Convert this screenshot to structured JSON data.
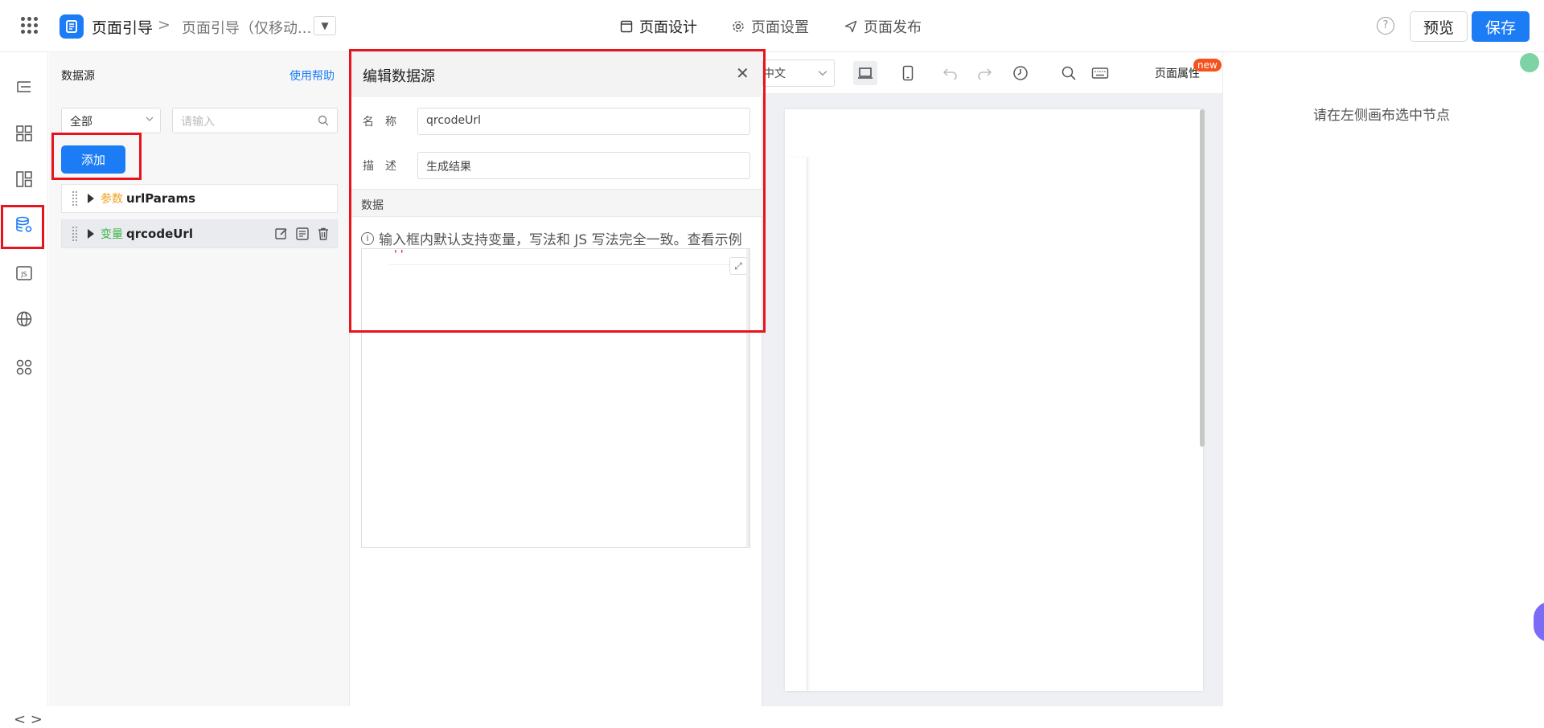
{
  "topbar": {
    "app_name": "页面引导",
    "breadcrumb_sep": ">",
    "breadcrumb_page": "页面引导（仅移动...",
    "tabs": [
      {
        "label": "页面设计"
      },
      {
        "label": "页面设置"
      },
      {
        "label": "页面发布"
      }
    ],
    "help_label": "?",
    "preview_label": "预览",
    "save_label": "保存"
  },
  "leftbar": {
    "code_label": "< >"
  },
  "datasource_panel": {
    "title": "数据源",
    "help_link": "使用帮助",
    "filter_value": "全部",
    "search_placeholder": "请输入",
    "add_label": "添加",
    "items": [
      {
        "tag": "参数",
        "name": "urlParams",
        "tag_color": "#f0a020"
      },
      {
        "tag": "变量",
        "name": "qrcodeUrl",
        "tag_color": "#3bb346"
      }
    ]
  },
  "editor": {
    "title": "编辑数据源",
    "close_label": "✕",
    "name_label": "名　称",
    "name_value": "qrcodeUrl",
    "desc_label": "描　述",
    "desc_value": "生成结果",
    "section_label": "数据",
    "info_text": "输入框内默认支持变量，写法和 JS 写法完全一致。查看示例",
    "code_value": "''",
    "expand_label": "⤢"
  },
  "canvas_toolbar": {
    "language": "中文",
    "page_props": "页面属性",
    "new_badge": "new"
  },
  "right_panel": {
    "hint": "请在左侧画布选中节点"
  },
  "colors": {
    "primary": "#1b7cf6",
    "highlight": "#e8131c"
  }
}
